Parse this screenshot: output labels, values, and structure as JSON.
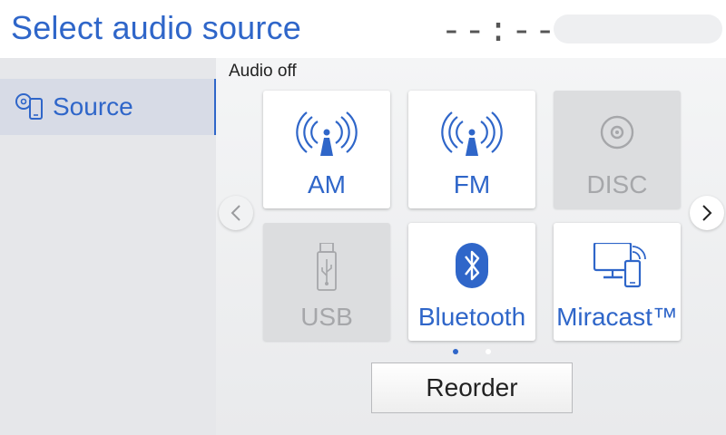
{
  "header": {
    "title": "Select audio source",
    "clock": "--:--"
  },
  "sidebar": {
    "items": [
      {
        "label": "Source",
        "icon": "source-icon",
        "selected": true
      }
    ]
  },
  "main": {
    "status": "Audio off",
    "tiles": [
      {
        "label": "AM",
        "icon": "radio-antenna-icon",
        "enabled": true
      },
      {
        "label": "FM",
        "icon": "radio-antenna-icon",
        "enabled": true
      },
      {
        "label": "DISC",
        "icon": "disc-icon",
        "enabled": false
      },
      {
        "label": "USB",
        "icon": "usb-icon",
        "enabled": false
      },
      {
        "label": "Bluetooth",
        "icon": "bluetooth-icon",
        "enabled": true
      },
      {
        "label": "Miracast™",
        "icon": "miracast-icon",
        "enabled": true
      }
    ],
    "pagination": {
      "current": 1,
      "total": 2
    },
    "reorder_label": "Reorder"
  },
  "colors": {
    "accent": "#2f66c9",
    "disabled_text": "#a6a7aa"
  }
}
